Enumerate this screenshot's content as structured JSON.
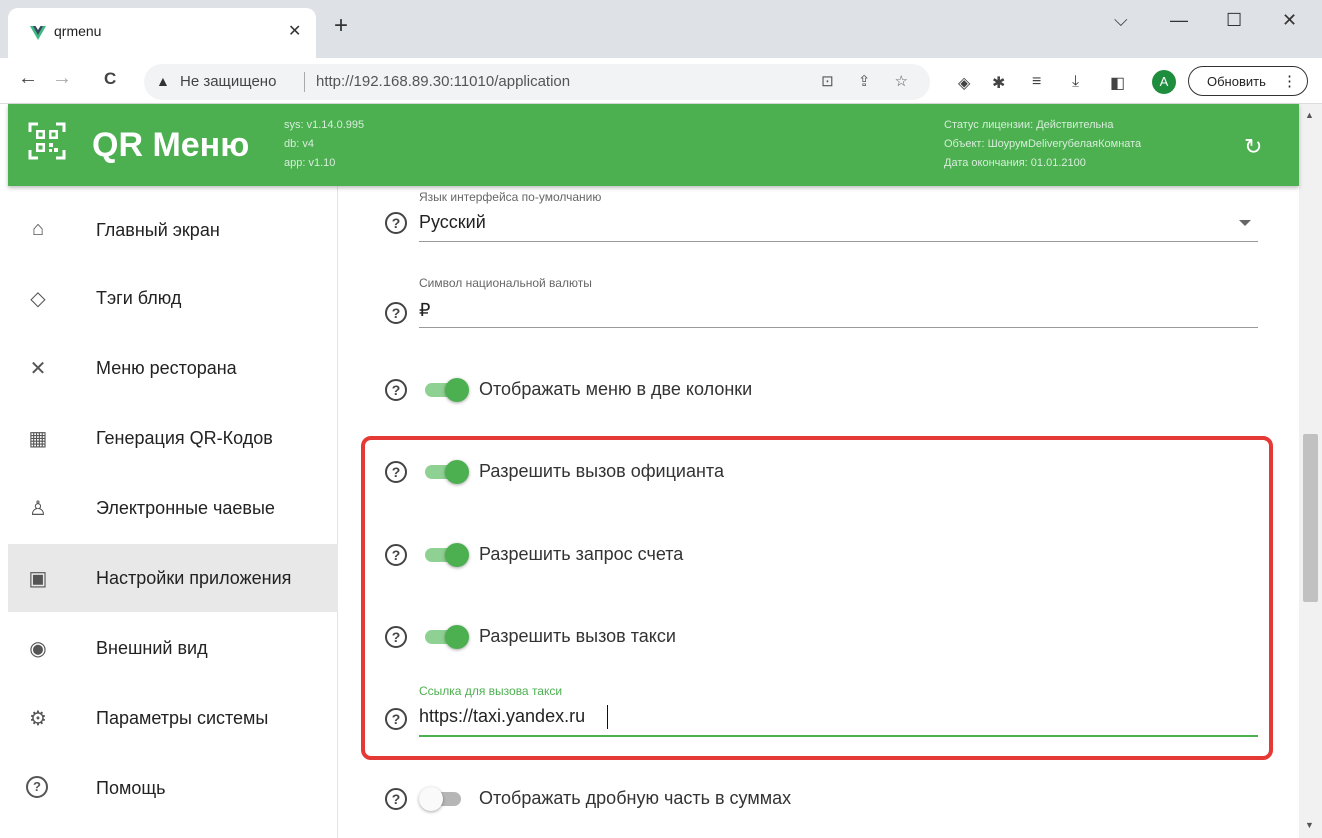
{
  "browser": {
    "tab_title": "qrmenu",
    "tab_close": "✕",
    "new_tab": "+",
    "window": {
      "minimize": "—",
      "maximize": "☐",
      "close": "✕",
      "dropdown": "⌵"
    },
    "nav": {
      "back": "←",
      "forward": "→",
      "reload": "C"
    },
    "insecure_icon": "▲",
    "insecure_label": "Не защищено",
    "url": "http://192.168.89.30:11010/application",
    "omnibox_icons": "⊡ ⇪ ☆",
    "toolbar_icons": [
      "◈",
      "✱",
      "≡",
      "⤓",
      "◧"
    ],
    "avatar_letter": "A",
    "update_label": "Обновить",
    "update_menu": "⋮"
  },
  "header": {
    "app_title": "QR Меню",
    "versions": [
      "sys: v1.14.0.995",
      "db: v4",
      "app: v1.10"
    ],
    "license": [
      "Статус лицензии: Действительна",
      "Объект: ШоурумDeliveryбелаяКомната",
      "Дата окончания: 01.01.2100"
    ],
    "refresh_icon": "↻"
  },
  "sidebar": {
    "items": [
      {
        "label": "Главный экран",
        "icon": "⌂"
      },
      {
        "label": "Тэги блюд",
        "icon": "◇"
      },
      {
        "label": "Меню ресторана",
        "icon": "✕"
      },
      {
        "label": "Генерация QR-Кодов",
        "icon": "▦"
      },
      {
        "label": "Электронные чаевые",
        "icon": "♙"
      },
      {
        "label": "Настройки приложения",
        "icon": "▣"
      },
      {
        "label": "Внешний вид",
        "icon": "◉"
      },
      {
        "label": "Параметры системы",
        "icon": "⚙"
      },
      {
        "label": "Помощь",
        "icon": "?"
      }
    ],
    "active_index": 5
  },
  "settings": {
    "help_glyph": "?",
    "language": {
      "label": "Язык интерфейса по-умолчанию",
      "value": "Русский"
    },
    "currency": {
      "label": "Символ национальной валюты",
      "value": "₽"
    },
    "two_columns": {
      "label": "Отображать меню в две колонки",
      "enabled": true
    },
    "call_waiter": {
      "label": "Разрешить вызов официанта",
      "enabled": true
    },
    "request_bill": {
      "label": "Разрешить запрос счета",
      "enabled": true
    },
    "call_taxi": {
      "label": "Разрешить вызов такси",
      "enabled": true
    },
    "taxi_link": {
      "label": "Ссылка для вызова такси",
      "value": "https://taxi.yandex.ru"
    },
    "fractional": {
      "label": "Отображать дробную часть в суммах",
      "enabled": false
    }
  },
  "colors": {
    "brand_green": "#4caf50",
    "highlight_red": "#e53935"
  }
}
